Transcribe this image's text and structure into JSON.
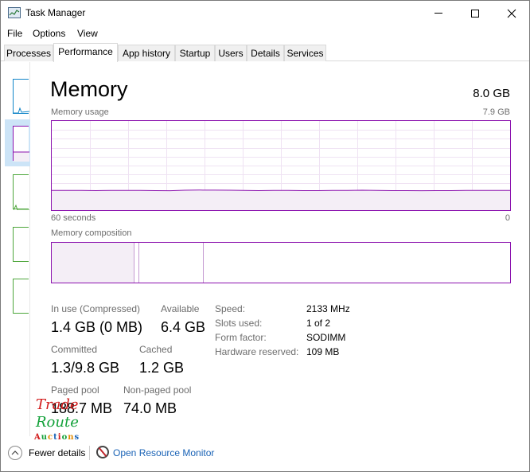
{
  "window": {
    "title": "Task Manager"
  },
  "menu": [
    "File",
    "Options",
    "View"
  ],
  "tabs": [
    {
      "label": "Processes"
    },
    {
      "label": "Performance"
    },
    {
      "label": "App history"
    },
    {
      "label": "Startup"
    },
    {
      "label": "Users"
    },
    {
      "label": "Details"
    },
    {
      "label": "Services"
    }
  ],
  "active_tab": "Performance",
  "panel": {
    "title": "Memory",
    "total": "8.0 GB",
    "usage_label": "Memory usage",
    "usage_max": "7.9 GB",
    "axis_left": "60 seconds",
    "axis_right": "0",
    "composition_label": "Memory composition"
  },
  "usage_graph": {
    "max_gb": 7.9,
    "samples_gb": [
      1.75,
      1.74,
      1.74,
      1.73,
      1.74,
      1.74,
      1.74,
      1.73,
      1.72,
      1.76,
      1.78,
      1.77,
      1.76,
      1.74,
      1.73,
      1.74,
      1.74,
      1.73,
      1.73,
      1.74,
      1.75,
      1.76,
      1.74,
      1.73,
      1.73,
      1.72,
      1.73,
      1.73,
      1.74,
      1.75,
      1.74,
      1.74
    ]
  },
  "composition": {
    "in_use_fraction": 0.18,
    "modified_fraction": 0.01,
    "standby_fraction": 0.14
  },
  "stats": {
    "in_use_label": "In use (Compressed)",
    "in_use_value": "1.4 GB (0 MB)",
    "available_label": "Available",
    "available_value": "6.4 GB",
    "committed_label": "Committed",
    "committed_value": "1.3/9.8 GB",
    "cached_label": "Cached",
    "cached_value": "1.2 GB",
    "paged_label": "Paged pool",
    "paged_value": "188.7 MB",
    "nonpaged_label": "Non-paged pool",
    "nonpaged_value": "74.0 MB"
  },
  "specs": {
    "speed_label": "Speed:",
    "speed_value": "2133 MHz",
    "slots_label": "Slots used:",
    "slots_value": "1 of 2",
    "form_label": "Form factor:",
    "form_value": "SODIMM",
    "reserved_label": "Hardware reserved:",
    "reserved_value": "109 MB"
  },
  "footer": {
    "fewer_details": "Fewer details",
    "resource_monitor": "Open Resource Monitor"
  },
  "watermark": {
    "line1": "Trade",
    "line2": "Route",
    "line3": "Auctions"
  },
  "colors": {
    "memory_accent": "#8b12ae",
    "cpu_accent": "#1185c8",
    "disk_accent": "#4da63b",
    "link": "#1a63b6"
  },
  "sidebar_icons": [
    "cpu-thumbnail",
    "memory-thumbnail",
    "disk-thumbnail",
    "disk-thumbnail",
    "network-thumbnail"
  ]
}
